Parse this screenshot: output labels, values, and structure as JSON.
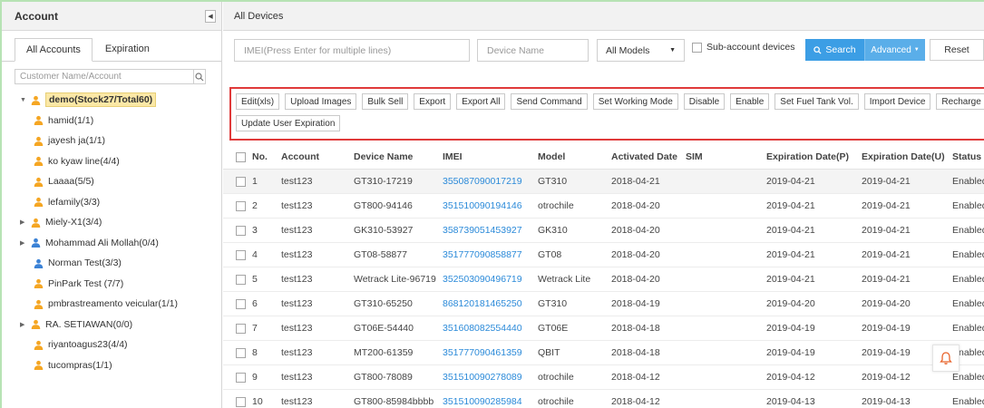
{
  "left": {
    "title": "Account",
    "tabs": [
      "All Accounts",
      "Expiration"
    ],
    "search_placeholder": "Customer Name/Account",
    "tree": [
      {
        "label": "demo(Stock27/Total60)",
        "level": 0,
        "arrow": "down",
        "color": "#f5a623",
        "root": true
      },
      {
        "label": "hamid(1/1)",
        "level": 1,
        "arrow": "",
        "color": "#f5a623"
      },
      {
        "label": "jayesh ja(1/1)",
        "level": 1,
        "arrow": "",
        "color": "#f5a623"
      },
      {
        "label": "ko kyaw line(4/4)",
        "level": 1,
        "arrow": "",
        "color": "#f5a623"
      },
      {
        "label": "Laaaa(5/5)",
        "level": 1,
        "arrow": "",
        "color": "#f5a623"
      },
      {
        "label": "lefamily(3/3)",
        "level": 1,
        "arrow": "",
        "color": "#f5a623"
      },
      {
        "label": "Miely-X1(3/4)",
        "level": 1,
        "arrow": "right",
        "color": "#f5a623"
      },
      {
        "label": "Mohammad Ali Mollah(0/4)",
        "level": 1,
        "arrow": "right",
        "color": "#3b82d6"
      },
      {
        "label": "Norman Test(3/3)",
        "level": 1,
        "arrow": "",
        "color": "#3b82d6"
      },
      {
        "label": "PinPark Test (7/7)",
        "level": 1,
        "arrow": "",
        "color": "#f5a623"
      },
      {
        "label": "pmbrastreamento veicular(1/1)",
        "level": 1,
        "arrow": "",
        "color": "#f5a623"
      },
      {
        "label": "RA. SETIAWAN(0/0)",
        "level": 1,
        "arrow": "right",
        "color": "#f5a623"
      },
      {
        "label": "riyantoagus23(4/4)",
        "level": 1,
        "arrow": "",
        "color": "#f5a623"
      },
      {
        "label": "tucompras(1/1)",
        "level": 1,
        "arrow": "",
        "color": "#f5a623"
      }
    ]
  },
  "right": {
    "title": "All Devices",
    "imei_placeholder": "IMEI(Press Enter for multiple lines)",
    "device_name_placeholder": "Device Name",
    "model_select": "All Models",
    "sub_account_label": "Sub-account devices",
    "search_label": "Search",
    "advanced_label": "Advanced",
    "reset_label": "Reset",
    "actions_row1": [
      "Edit(xls)",
      "Upload Images",
      "Bulk Sell",
      "Export",
      "Export All",
      "Send Command",
      "Set Working Mode",
      "Disable",
      "Enable",
      "Set Fuel Tank Vol.",
      "Import Device",
      "Recharge"
    ],
    "actions_row2": [
      "Update User Expiration"
    ],
    "columns": [
      "No.",
      "Account",
      "Device Name",
      "IMEI",
      "Model",
      "Activated Date",
      "SIM",
      "Expiration Date(P)",
      "Expiration Date(U)",
      "Status"
    ],
    "rows": [
      {
        "no": "1",
        "account": "test123",
        "device": "GT310-17219",
        "imei": "355087090017219",
        "model": "GT310",
        "activated": "2018-04-21",
        "sim": "",
        "exp_p": "2019-04-21",
        "exp_u": "2019-04-21",
        "status": "Enabled"
      },
      {
        "no": "2",
        "account": "test123",
        "device": "GT800-94146",
        "imei": "351510090194146",
        "model": "otrochile",
        "activated": "2018-04-20",
        "sim": "",
        "exp_p": "2019-04-21",
        "exp_u": "2019-04-21",
        "status": "Enabled"
      },
      {
        "no": "3",
        "account": "test123",
        "device": "GK310-53927",
        "imei": "358739051453927",
        "model": "GK310",
        "activated": "2018-04-20",
        "sim": "",
        "exp_p": "2019-04-21",
        "exp_u": "2019-04-21",
        "status": "Enabled"
      },
      {
        "no": "4",
        "account": "test123",
        "device": "GT08-58877",
        "imei": "351777090858877",
        "model": "GT08",
        "activated": "2018-04-20",
        "sim": "",
        "exp_p": "2019-04-21",
        "exp_u": "2019-04-21",
        "status": "Enabled"
      },
      {
        "no": "5",
        "account": "test123",
        "device": "Wetrack Lite-96719",
        "imei": "352503090496719",
        "model": "Wetrack Lite",
        "activated": "2018-04-20",
        "sim": "",
        "exp_p": "2019-04-21",
        "exp_u": "2019-04-21",
        "status": "Enabled"
      },
      {
        "no": "6",
        "account": "test123",
        "device": "GT310-65250",
        "imei": "868120181465250",
        "model": "GT310",
        "activated": "2018-04-19",
        "sim": "",
        "exp_p": "2019-04-20",
        "exp_u": "2019-04-20",
        "status": "Enabled"
      },
      {
        "no": "7",
        "account": "test123",
        "device": "GT06E-54440",
        "imei": "351608082554440",
        "model": "GT06E",
        "activated": "2018-04-18",
        "sim": "",
        "exp_p": "2019-04-19",
        "exp_u": "2019-04-19",
        "status": "Enabled"
      },
      {
        "no": "8",
        "account": "test123",
        "device": "MT200-61359",
        "imei": "351777090461359",
        "model": "QBIT",
        "activated": "2018-04-18",
        "sim": "",
        "exp_p": "2019-04-19",
        "exp_u": "2019-04-19",
        "status": "Enabled"
      },
      {
        "no": "9",
        "account": "test123",
        "device": "GT800-78089",
        "imei": "351510090278089",
        "model": "otrochile",
        "activated": "2018-04-12",
        "sim": "",
        "exp_p": "2019-04-12",
        "exp_u": "2019-04-12",
        "status": "Enabled"
      },
      {
        "no": "10",
        "account": "test123",
        "device": "GT800-85984bbbb",
        "imei": "351510090285984",
        "model": "otrochile",
        "activated": "2018-04-12",
        "sim": "",
        "exp_p": "2019-04-13",
        "exp_u": "2019-04-13",
        "status": "Enabled"
      }
    ]
  },
  "colors": {
    "accent": "#3c9ee5",
    "highlight_border": "#e03a3a",
    "link": "#2b8ad9",
    "frame": "#b7e3b4"
  }
}
